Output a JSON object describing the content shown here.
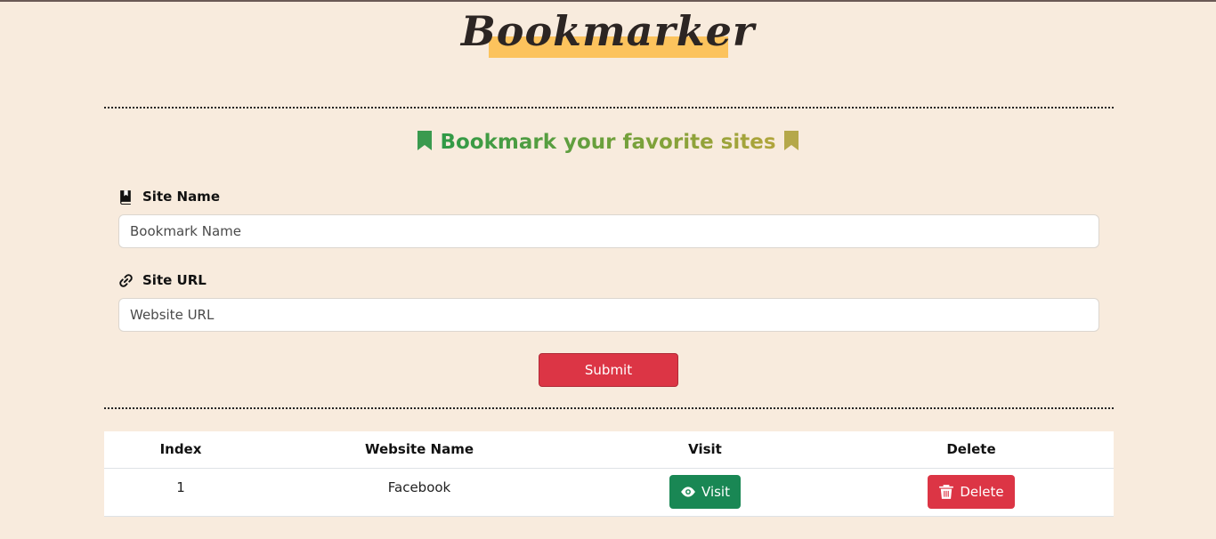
{
  "app": {
    "title": "Bookmarker"
  },
  "headline": {
    "text": "Bookmark your favorite sites"
  },
  "form": {
    "site_name_label": "Site Name",
    "site_name_placeholder": "Bookmark Name",
    "site_url_label": "Site URL",
    "site_url_placeholder": "Website URL",
    "submit_label": "Submit"
  },
  "table": {
    "headers": [
      "Index",
      "Website Name",
      "Visit",
      "Delete"
    ],
    "rows": [
      {
        "index": "1",
        "name": "Facebook",
        "visit_label": "Visit",
        "delete_label": "Delete"
      }
    ]
  },
  "colors": {
    "background": "#f8ebdd",
    "accent_yellow": "#fcc35d",
    "danger": "#dc3545",
    "success": "#198754"
  },
  "icons": {
    "headline_left": "bookmark-icon",
    "headline_right": "bookmark-icon",
    "site_name": "book-bookmark-icon",
    "site_url": "link-icon",
    "visit": "eye-icon",
    "delete": "trash-icon"
  }
}
